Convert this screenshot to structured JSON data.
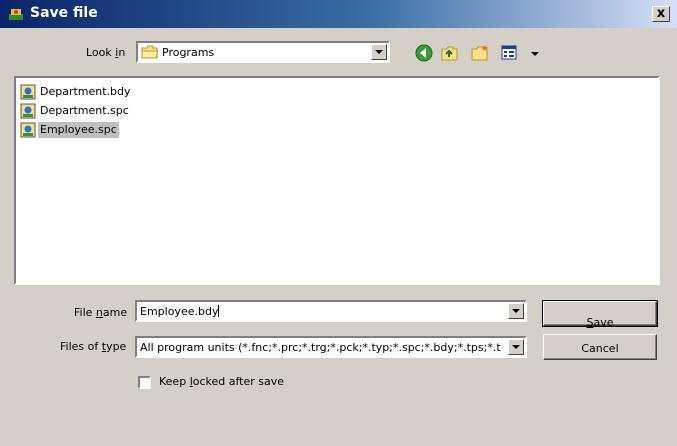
{
  "window": {
    "title": "Save file",
    "close_label": "x"
  },
  "look_in": {
    "label_pre": "Look ",
    "label_underlined": "i",
    "label_post": "n",
    "value": "Programs"
  },
  "toolbar": {
    "icons": [
      "back-icon",
      "up-folder-icon",
      "new-folder-icon",
      "view-menu-icon"
    ]
  },
  "files": [
    {
      "name": "Department.bdy",
      "selected": false
    },
    {
      "name": "Department.spc",
      "selected": false
    },
    {
      "name": "Employee.spc",
      "selected": true
    }
  ],
  "file_name": {
    "label_pre": "File ",
    "label_underlined": "n",
    "label_post": "ame",
    "value": "Employee.bdy"
  },
  "file_type": {
    "label_pre": "Files of ",
    "label_underlined": "t",
    "label_post": "ype",
    "value": "All program units (*.fnc;*.prc;*.trg;*.pck;*.typ;*.spc;*.bdy;*.tps;*.t"
  },
  "buttons": {
    "save_underlined": "S",
    "save_rest": "ave",
    "cancel": "Cancel"
  },
  "keep_locked": {
    "label_pre": "Keep ",
    "label_underlined": "l",
    "label_post": "ocked after save",
    "checked": false
  },
  "colors": {
    "titlebar_start": "#0a246a",
    "titlebar_end": "#d6dff7",
    "dialog_bg": "#d4d0c8",
    "selection": "#c0c0c0"
  }
}
